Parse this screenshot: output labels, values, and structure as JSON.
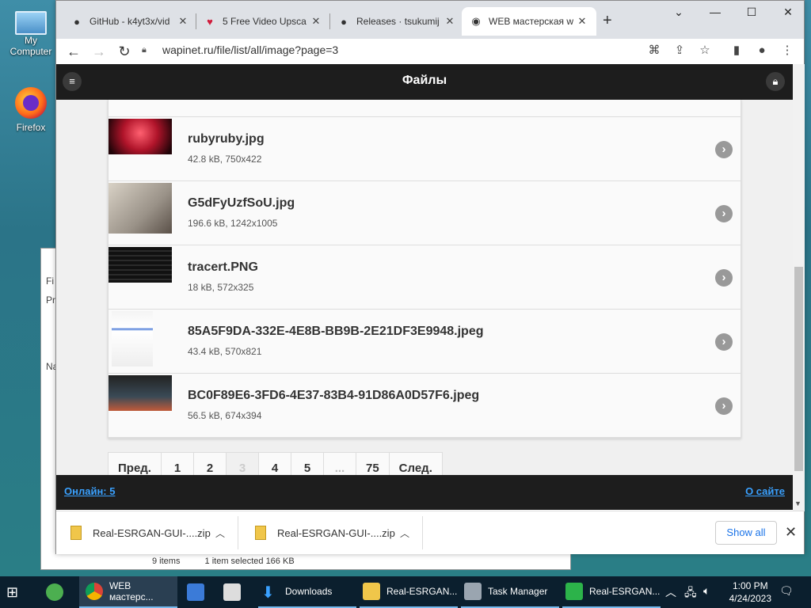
{
  "desktop": {
    "icons": [
      {
        "label": "My Computer",
        "icon": "computer-icon"
      },
      {
        "label": "Firefox",
        "icon": "firefox-icon"
      }
    ],
    "explorer_behind": {
      "side_labels": [
        "Fi",
        "Pr",
        "Na"
      ],
      "status_items": "9 items",
      "status_selected": "1 item selected  166 KB"
    }
  },
  "browser": {
    "tabs": [
      {
        "label": "GitHub - k4yt3x/vid",
        "icon": "github-icon"
      },
      {
        "label": "5 Free Video Upsca",
        "icon": "heart-icon"
      },
      {
        "label": "Releases · tsukumij",
        "icon": "github-icon"
      },
      {
        "label": "WEB мастерская w",
        "icon": "eye-icon",
        "active": true
      }
    ],
    "url": "wapinet.ru/file/list/all/image?page=3"
  },
  "site": {
    "header_title": "Файлы",
    "files": [
      {
        "name": "rubyruby.jpg",
        "meta": "42.8 kB, 750x422",
        "thumb_color": "#b0142a"
      },
      {
        "name": "G5dFyUzfSoU.jpg",
        "meta": "196.6 kB, 1242x1005",
        "thumb_color": "#c8c2b8"
      },
      {
        "name": "tracert.PNG",
        "meta": "18 kB, 572x325",
        "thumb_color": "#111111"
      },
      {
        "name": "85A5F9DA-332E-4E8B-BB9B-2E21DF3E9948.jpeg",
        "meta": "43.4 kB, 570x821",
        "thumb_color": "#f4f4f4"
      },
      {
        "name": "BC0F89E6-3FD6-4E37-83B4-91D86A0D57F6.jpeg",
        "meta": "56.5 kB, 674x394",
        "thumb_color": "#2c3a44"
      }
    ],
    "pager": [
      "Пред.",
      "1",
      "2",
      "3",
      "4",
      "5",
      "...",
      "75",
      "След."
    ],
    "pager_current": "3",
    "footer_left": "Онлайн: 5",
    "footer_right": "О сайте"
  },
  "downloads": {
    "items": [
      "Real-ESRGAN-GUI-....zip",
      "Real-ESRGAN-GUI-....zip"
    ],
    "show_all": "Show all"
  },
  "taskbar": {
    "items": [
      {
        "label": "WEB мастерс...",
        "icon": "chrome-icon"
      },
      {
        "label": "Downloads",
        "icon": "download-icon"
      },
      {
        "label": "Real-ESRGAN...",
        "icon": "folder-icon"
      },
      {
        "label": "Task Manager",
        "icon": "task-manager-icon"
      },
      {
        "label": "Real-ESRGAN...",
        "icon": "app-icon"
      }
    ],
    "time": "1:00 PM",
    "date": "4/24/2023"
  },
  "colors": {
    "accent_link": "#3aa1ff",
    "header_bg": "#1d1d1d"
  }
}
